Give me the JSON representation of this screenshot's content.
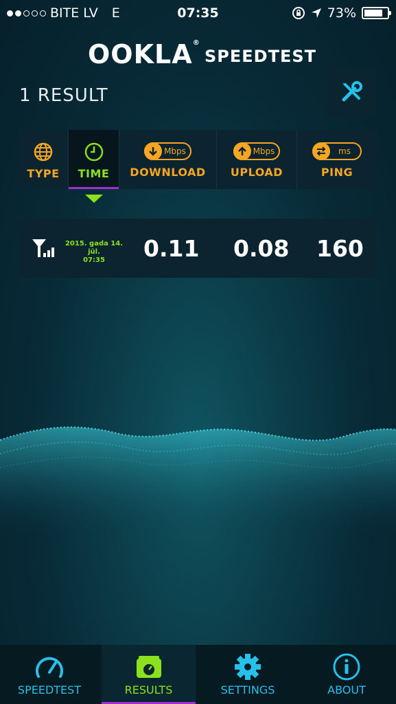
{
  "status": {
    "carrier": "BITE LV",
    "network": "E",
    "time": "07:35",
    "battery": "73%",
    "signal_bars": 2
  },
  "header": {
    "logo": "OOKLA",
    "logo_mark": "®",
    "title": "SPEEDTEST"
  },
  "results_header": {
    "count_label": "1 RESULT"
  },
  "columns": [
    {
      "label": "TYPE",
      "icon": "globe-icon"
    },
    {
      "label": "TIME",
      "icon": "clock-icon"
    },
    {
      "label": "DOWNLOAD",
      "unit": "Mbps",
      "icon": "download-arrow-icon"
    },
    {
      "label": "UPLOAD",
      "unit": "Mbps",
      "icon": "upload-arrow-icon"
    },
    {
      "label": "PING",
      "unit": "ms",
      "icon": "ping-arrows-icon"
    }
  ],
  "results": [
    {
      "type_icon": "cellular-signal-icon",
      "date": "2015. gada 14. jūl.",
      "time": "07:35",
      "download": "0.11",
      "upload": "0.08",
      "ping": "160"
    }
  ],
  "tabbar": [
    {
      "label": "SPEEDTEST",
      "icon": "speedometer-icon"
    },
    {
      "label": "RESULTS",
      "icon": "folder-icon",
      "active": true
    },
    {
      "label": "SETTINGS",
      "icon": "gear-icon"
    },
    {
      "label": "ABOUT",
      "icon": "info-icon"
    }
  ],
  "colors": {
    "accent_orange": "#f6a623",
    "accent_green": "#8be21c",
    "accent_cyan": "#26c1ea",
    "accent_purple": "#a02fd0"
  }
}
